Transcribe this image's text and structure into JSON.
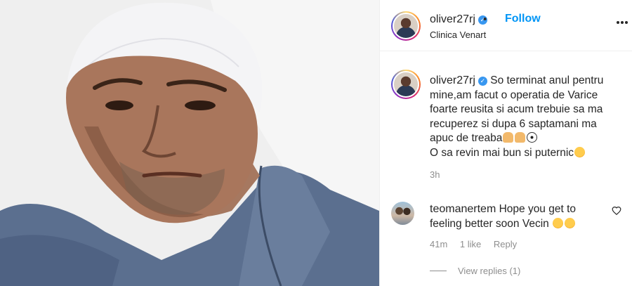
{
  "header": {
    "username": "oliver27rj",
    "separator": "•",
    "follow_label": "Follow",
    "location": "Clinica Venart"
  },
  "caption": {
    "username": "oliver27rj",
    "text_lines": [
      "So terminat anul pentru",
      "mine,am facut o operatia de Varice",
      "foarte reusita si acum trebuie sa ma",
      "recuperez si dupa 6 saptamani ma",
      "apuc de treaba",
      "O sa revin mai bun si puternic"
    ],
    "emojis_line4": [
      "hands-emoji",
      "pray-emoji",
      "soccer-ball-emoji"
    ],
    "emoji_line5": "smiling-hearts-emoji",
    "time": "3h"
  },
  "comment": {
    "username": "teomanertem",
    "text_part1": "Hope you get to",
    "text_part2": "feeling better soon Vecin",
    "emojis": [
      "hugging-emoji",
      "hugging-emoji"
    ],
    "time": "41m",
    "likes": "1 like",
    "reply_label": "Reply",
    "view_replies": "View replies (1)"
  },
  "colors": {
    "link_blue": "#0095f6",
    "verified_blue": "#3897f0",
    "muted": "#8e8e8e",
    "text": "#262626"
  }
}
